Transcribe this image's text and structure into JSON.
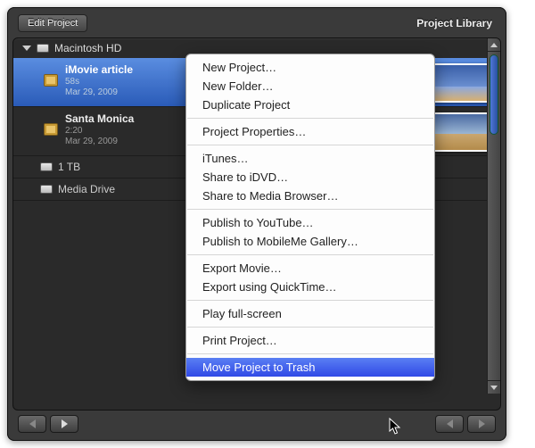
{
  "toolbar": {
    "edit_label": "Edit Project",
    "library_label": "Project Library"
  },
  "disks": [
    {
      "name": "Macintosh HD",
      "expanded": true
    },
    {
      "name": "1 TB",
      "expanded": false
    },
    {
      "name": "Media Drive",
      "expanded": false
    }
  ],
  "projects": [
    {
      "name": "iMovie article",
      "duration": "58s",
      "date": "Mar 29, 2009",
      "selected": true
    },
    {
      "name": "Santa Monica",
      "duration": "2:20",
      "date": "Mar 29, 2009",
      "selected": false
    }
  ],
  "context_menu": {
    "groups": [
      [
        "New Project…",
        "New Folder…",
        "Duplicate Project"
      ],
      [
        "Project Properties…"
      ],
      [
        "iTunes…",
        "Share to iDVD…",
        "Share to Media Browser…"
      ],
      [
        "Publish to YouTube…",
        "Publish to MobileMe Gallery…"
      ],
      [
        "Export Movie…",
        "Export using QuickTime…"
      ],
      [
        "Play full-screen"
      ],
      [
        "Print Project…"
      ],
      [
        "Move Project to Trash"
      ]
    ],
    "highlighted": "Move Project to Trash"
  }
}
